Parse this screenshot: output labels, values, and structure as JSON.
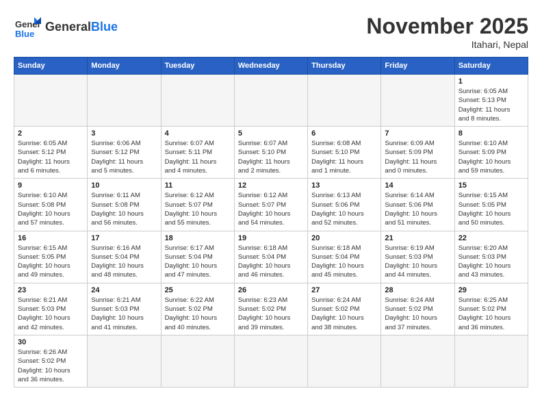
{
  "header": {
    "logo_general": "General",
    "logo_blue": "Blue",
    "month": "November 2025",
    "location": "Itahari, Nepal"
  },
  "days_of_week": [
    "Sunday",
    "Monday",
    "Tuesday",
    "Wednesday",
    "Thursday",
    "Friday",
    "Saturday"
  ],
  "weeks": [
    [
      {
        "day": "",
        "info": ""
      },
      {
        "day": "",
        "info": ""
      },
      {
        "day": "",
        "info": ""
      },
      {
        "day": "",
        "info": ""
      },
      {
        "day": "",
        "info": ""
      },
      {
        "day": "",
        "info": ""
      },
      {
        "day": "1",
        "info": "Sunrise: 6:05 AM\nSunset: 5:13 PM\nDaylight: 11 hours\nand 8 minutes."
      }
    ],
    [
      {
        "day": "2",
        "info": "Sunrise: 6:05 AM\nSunset: 5:12 PM\nDaylight: 11 hours\nand 6 minutes."
      },
      {
        "day": "3",
        "info": "Sunrise: 6:06 AM\nSunset: 5:12 PM\nDaylight: 11 hours\nand 5 minutes."
      },
      {
        "day": "4",
        "info": "Sunrise: 6:07 AM\nSunset: 5:11 PM\nDaylight: 11 hours\nand 4 minutes."
      },
      {
        "day": "5",
        "info": "Sunrise: 6:07 AM\nSunset: 5:10 PM\nDaylight: 11 hours\nand 2 minutes."
      },
      {
        "day": "6",
        "info": "Sunrise: 6:08 AM\nSunset: 5:10 PM\nDaylight: 11 hours\nand 1 minute."
      },
      {
        "day": "7",
        "info": "Sunrise: 6:09 AM\nSunset: 5:09 PM\nDaylight: 11 hours\nand 0 minutes."
      },
      {
        "day": "8",
        "info": "Sunrise: 6:10 AM\nSunset: 5:09 PM\nDaylight: 10 hours\nand 59 minutes."
      }
    ],
    [
      {
        "day": "9",
        "info": "Sunrise: 6:10 AM\nSunset: 5:08 PM\nDaylight: 10 hours\nand 57 minutes."
      },
      {
        "day": "10",
        "info": "Sunrise: 6:11 AM\nSunset: 5:08 PM\nDaylight: 10 hours\nand 56 minutes."
      },
      {
        "day": "11",
        "info": "Sunrise: 6:12 AM\nSunset: 5:07 PM\nDaylight: 10 hours\nand 55 minutes."
      },
      {
        "day": "12",
        "info": "Sunrise: 6:12 AM\nSunset: 5:07 PM\nDaylight: 10 hours\nand 54 minutes."
      },
      {
        "day": "13",
        "info": "Sunrise: 6:13 AM\nSunset: 5:06 PM\nDaylight: 10 hours\nand 52 minutes."
      },
      {
        "day": "14",
        "info": "Sunrise: 6:14 AM\nSunset: 5:06 PM\nDaylight: 10 hours\nand 51 minutes."
      },
      {
        "day": "15",
        "info": "Sunrise: 6:15 AM\nSunset: 5:05 PM\nDaylight: 10 hours\nand 50 minutes."
      }
    ],
    [
      {
        "day": "16",
        "info": "Sunrise: 6:15 AM\nSunset: 5:05 PM\nDaylight: 10 hours\nand 49 minutes."
      },
      {
        "day": "17",
        "info": "Sunrise: 6:16 AM\nSunset: 5:04 PM\nDaylight: 10 hours\nand 48 minutes."
      },
      {
        "day": "18",
        "info": "Sunrise: 6:17 AM\nSunset: 5:04 PM\nDaylight: 10 hours\nand 47 minutes."
      },
      {
        "day": "19",
        "info": "Sunrise: 6:18 AM\nSunset: 5:04 PM\nDaylight: 10 hours\nand 46 minutes."
      },
      {
        "day": "20",
        "info": "Sunrise: 6:18 AM\nSunset: 5:04 PM\nDaylight: 10 hours\nand 45 minutes."
      },
      {
        "day": "21",
        "info": "Sunrise: 6:19 AM\nSunset: 5:03 PM\nDaylight: 10 hours\nand 44 minutes."
      },
      {
        "day": "22",
        "info": "Sunrise: 6:20 AM\nSunset: 5:03 PM\nDaylight: 10 hours\nand 43 minutes."
      }
    ],
    [
      {
        "day": "23",
        "info": "Sunrise: 6:21 AM\nSunset: 5:03 PM\nDaylight: 10 hours\nand 42 minutes."
      },
      {
        "day": "24",
        "info": "Sunrise: 6:21 AM\nSunset: 5:03 PM\nDaylight: 10 hours\nand 41 minutes."
      },
      {
        "day": "25",
        "info": "Sunrise: 6:22 AM\nSunset: 5:02 PM\nDaylight: 10 hours\nand 40 minutes."
      },
      {
        "day": "26",
        "info": "Sunrise: 6:23 AM\nSunset: 5:02 PM\nDaylight: 10 hours\nand 39 minutes."
      },
      {
        "day": "27",
        "info": "Sunrise: 6:24 AM\nSunset: 5:02 PM\nDaylight: 10 hours\nand 38 minutes."
      },
      {
        "day": "28",
        "info": "Sunrise: 6:24 AM\nSunset: 5:02 PM\nDaylight: 10 hours\nand 37 minutes."
      },
      {
        "day": "29",
        "info": "Sunrise: 6:25 AM\nSunset: 5:02 PM\nDaylight: 10 hours\nand 36 minutes."
      }
    ],
    [
      {
        "day": "30",
        "info": "Sunrise: 6:26 AM\nSunset: 5:02 PM\nDaylight: 10 hours\nand 36 minutes."
      },
      {
        "day": "",
        "info": ""
      },
      {
        "day": "",
        "info": ""
      },
      {
        "day": "",
        "info": ""
      },
      {
        "day": "",
        "info": ""
      },
      {
        "day": "",
        "info": ""
      },
      {
        "day": "",
        "info": ""
      }
    ]
  ]
}
